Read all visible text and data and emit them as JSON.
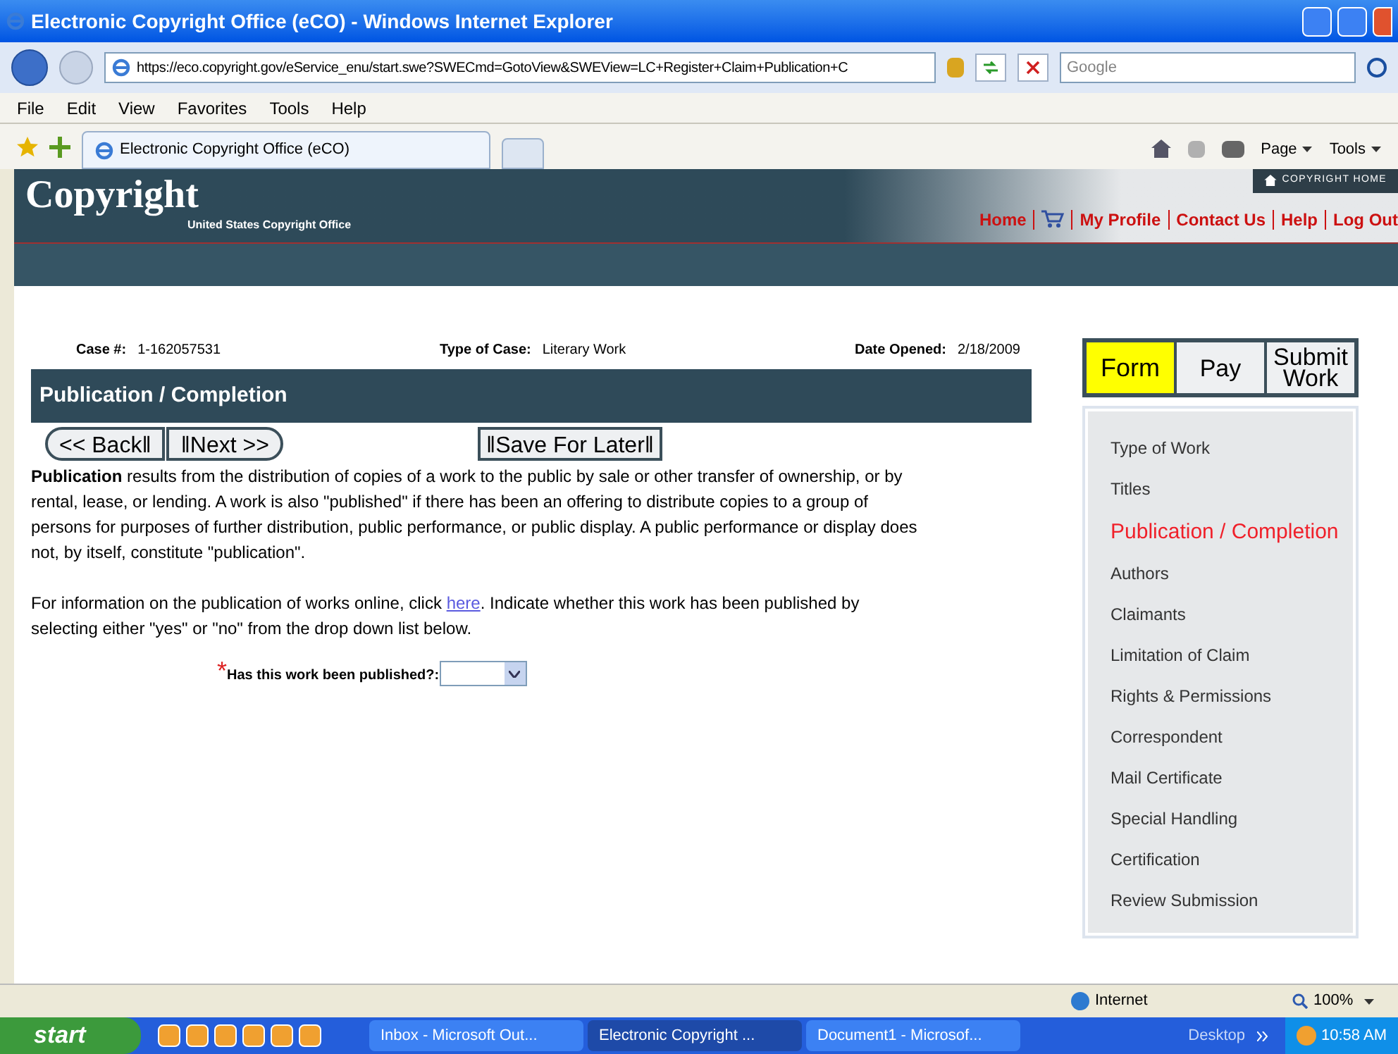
{
  "window": {
    "title": "Electronic Copyright Office (eCO) - Windows Internet Explorer"
  },
  "address_bar": {
    "url": "https://eco.copyright.gov/eService_enu/start.swe?SWECmd=GotoView&SWEView=LC+Register+Claim+Publication+C"
  },
  "search": {
    "placeholder": "Google"
  },
  "menu": [
    "File",
    "Edit",
    "View",
    "Favorites",
    "Tools",
    "Help"
  ],
  "browser_tab": {
    "title": "Electronic Copyright Office (eCO)"
  },
  "toolbar": [
    "Page",
    "Tools"
  ],
  "header": {
    "logo": "Copyright",
    "subtitle": "United States Copyright Office",
    "home_button": "COPYRIGHT HOME",
    "nav": [
      {
        "kind": "link",
        "label": "Home"
      },
      {
        "kind": "cart"
      },
      {
        "kind": "link",
        "label": "My Profile"
      },
      {
        "kind": "link",
        "label": "Contact Us"
      },
      {
        "kind": "link",
        "label": "Help"
      },
      {
        "kind": "link",
        "label": "Log Out"
      }
    ]
  },
  "case_info": [
    {
      "label": "Case #:",
      "value": "1-162057531"
    },
    {
      "label": "Type of Case:",
      "value": "Literary Work"
    },
    {
      "label": "Date Opened:",
      "value": "2/18/2009"
    }
  ],
  "section_title": "Publication / Completion",
  "buttons": {
    "back": "<< Back‖",
    "next": "‖Next >>",
    "save": "‖Save For Later‖"
  },
  "intro": "**Publication** results from the distribution of copies of a work to the public by sale or other transfer of ownership, or by rental, lease, or lending. A work is also \"published\" if there has been an offering to distribute copies to a group of persons for purposes of further distribution, public performance, or public display. A public performance or display does not, by itself, constitute \"publication\".",
  "info": {
    "before": "For information on the publication of works online, click",
    "link": "here",
    "after": ". Indicate whether this work has been published by selecting either \"yes\" or \"no\" from the drop down list below."
  },
  "question": {
    "label": "Has this work been published?:",
    "required_mark": "*"
  },
  "step_tabs": [
    {
      "label": "Form",
      "selected": true
    },
    {
      "label": "Pay",
      "selected": false
    },
    {
      "label": "Submit Work",
      "selected": false
    }
  ],
  "steps": [
    {
      "label": "Type of Work",
      "selected": false
    },
    {
      "label": "Titles",
      "selected": false
    },
    {
      "label": "Publication / Completion",
      "selected": true
    },
    {
      "label": "Authors",
      "selected": false
    },
    {
      "label": "Claimants",
      "selected": false
    },
    {
      "label": "Limitation of Claim",
      "selected": false
    },
    {
      "label": "Rights & Permissions",
      "selected": false
    },
    {
      "label": "Correspondent",
      "selected": false
    },
    {
      "label": "Mail Certificate",
      "selected": false
    },
    {
      "label": "Special Handling",
      "selected": false
    },
    {
      "label": "Certification",
      "selected": false
    },
    {
      "label": "Review Submission",
      "selected": false
    }
  ],
  "status_bar": {
    "zone": "Internet",
    "zoom": "100%"
  },
  "taskbar": {
    "start": "start",
    "tasks": [
      {
        "label": "Inbox - Microsoft Out...",
        "selected": false
      },
      {
        "label": "Electronic Copyright ...",
        "selected": true
      },
      {
        "label": "Document1 - Microsof...",
        "selected": false
      }
    ],
    "desktop": "Desktop",
    "clock": "10:58 AM"
  }
}
